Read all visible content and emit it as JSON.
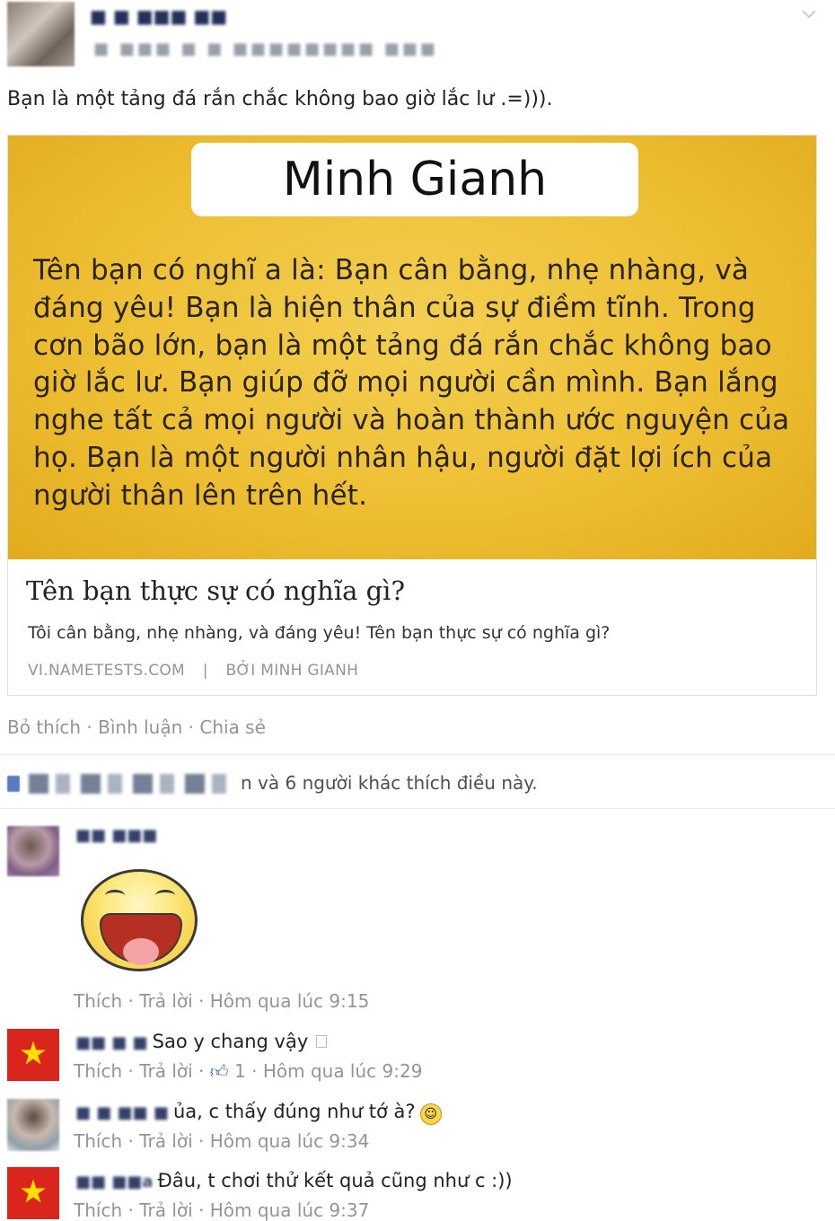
{
  "post": {
    "author_name": "■ ■ ■■■ ■■",
    "timestamp": "■ ■■■ ■ ■ ■■■■■■■■ ■■■",
    "caption": "Bạn là một tảng đá rắn chắc không bao giờ lắc lư .=)))."
  },
  "card": {
    "name": "Minh Gianh",
    "meaning": "Tên bạn có nghĩ a là: Bạn cân bằng, nhẹ nhàng, và đáng yêu! Bạn là hiện thân của sự điềm tĩnh. Trong cơn bão lớn, bạn là một tảng đá rắn chắc không bao giờ lắc lư. Bạn giúp đỡ mọi người cần mình. Bạn lắng nghe tất cả mọi người và hoàn thành ước nguyện của họ. Bạn là một người nhân hậu, người đặt lợi ích của người thân lên trên hết.",
    "link_title": "Tên bạn thực sự có nghĩa gì?",
    "link_desc": "Tôi cân bằng, nhẹ nhàng, và đáng yêu! Tên bạn thực sự có nghĩa gì?",
    "source_domain": "VI.NAMETESTS.COM",
    "source_sep": "|",
    "source_author": "BỞI MINH GIANH"
  },
  "actions": {
    "unlike": "Bỏ thích",
    "comment": "Bình luận",
    "share": "Chia sẻ",
    "sep": "·"
  },
  "likes_summary": "n và 6 người khác thích điều này.",
  "comments": [
    {
      "author": "■■ ■■■",
      "text": "",
      "like": "Thích",
      "reply": "Trả lời",
      "likes": "",
      "time": "Hôm qua lúc 9:15"
    },
    {
      "author": "■■ ■ ■",
      "text": "Sao y chang vậy",
      "like": "Thích",
      "reply": "Trả lời",
      "likes": "1",
      "time": "Hôm qua lúc 9:29"
    },
    {
      "author": "■ ■ ■■ ■",
      "text": "ủa, c thấy đúng như tớ à?",
      "like": "Thích",
      "reply": "Trả lời",
      "likes": "",
      "time": "Hôm qua lúc 9:34"
    },
    {
      "author": "■■ ■■a",
      "text": "Đâu, t chơi thử kết quả cũng như c :))",
      "like": "Thích",
      "reply": "Trả lời",
      "likes": "",
      "time": "Hôm qua lúc 9:37"
    }
  ],
  "colors": {
    "card_yellow": "#eebf33",
    "meta_grey": "#90949c",
    "flag_red": "#da251d",
    "flag_star": "#ffde00"
  }
}
